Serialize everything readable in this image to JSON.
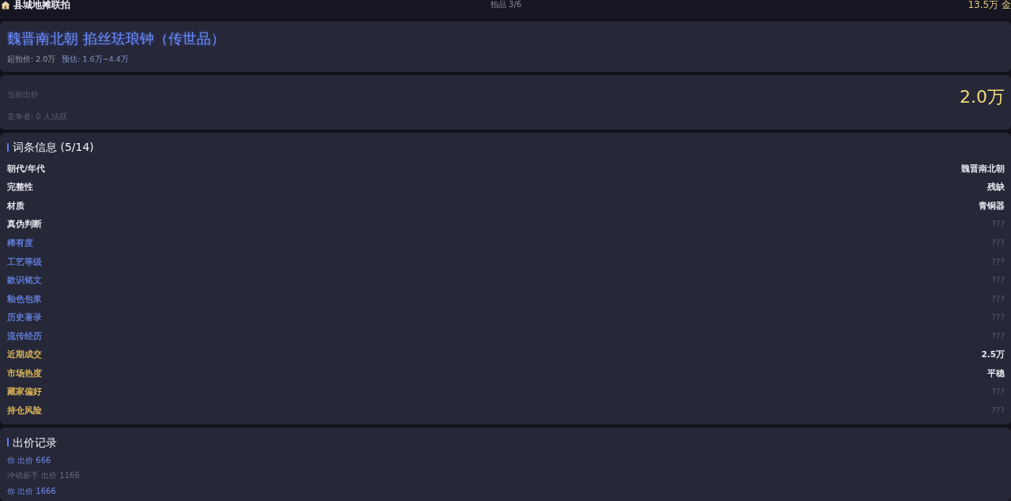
{
  "top_bar": {
    "title": "县城地摊联拍",
    "lot": "拍品 3/6",
    "balance": "13.5万 金"
  },
  "item": {
    "name": "魏晋南北朝 掐丝珐琅钟（传世品）",
    "starting_price": "起拍价: 2.0万",
    "estimate": "预估: 1.6万~4.4万"
  },
  "bid_status": {
    "label": "当前出价",
    "amount": "2.0万",
    "competitors": "竞争者: 0 人活跃"
  },
  "attributes": {
    "title": "词条信息 (5/14)",
    "rows": [
      {
        "label": "朝代/年代",
        "value": "魏晋南北朝",
        "kind": "basic",
        "revealed": true
      },
      {
        "label": "完整性",
        "value": "残缺",
        "kind": "basic",
        "revealed": true
      },
      {
        "label": "材质",
        "value": "青铜器",
        "kind": "basic",
        "revealed": true
      },
      {
        "label": "真伪判断",
        "value": "???",
        "kind": "basic",
        "revealed": false
      },
      {
        "label": "稀有度",
        "value": "???",
        "kind": "expert",
        "revealed": false
      },
      {
        "label": "工艺等级",
        "value": "???",
        "kind": "expert",
        "revealed": false
      },
      {
        "label": "款识铭文",
        "value": "???",
        "kind": "expert",
        "revealed": false
      },
      {
        "label": "釉色包浆",
        "value": "???",
        "kind": "expert",
        "revealed": false
      },
      {
        "label": "历史著录",
        "value": "???",
        "kind": "expert",
        "revealed": false
      },
      {
        "label": "流传经历",
        "value": "???",
        "kind": "expert",
        "revealed": false
      },
      {
        "label": "近期成交",
        "value": "2.5万",
        "kind": "market",
        "revealed": true
      },
      {
        "label": "市场热度",
        "value": "平稳",
        "kind": "market",
        "revealed": true
      },
      {
        "label": "藏家偏好",
        "value": "???",
        "kind": "market",
        "revealed": false
      },
      {
        "label": "持仓风险",
        "value": "???",
        "kind": "market",
        "revealed": false
      }
    ]
  },
  "bid_history": {
    "title": "出价记录",
    "items": [
      {
        "text": "你 出价 666",
        "mine": true
      },
      {
        "text": "冲动新手 出价 1166",
        "mine": false
      },
      {
        "text": "你 出价 1666",
        "mine": true
      }
    ]
  }
}
